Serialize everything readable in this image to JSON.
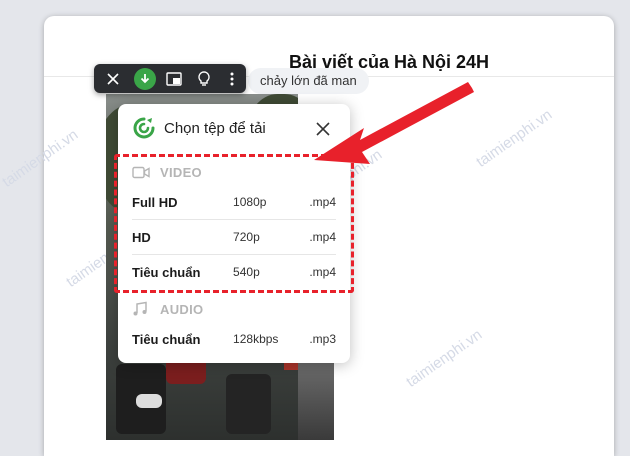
{
  "page": {
    "title": "Bài viết của Hà Nội 24H",
    "snippet": "chảy lớn đã man"
  },
  "watermark": "taimienphi.vn",
  "toolbar": {
    "buttons": [
      {
        "name": "close",
        "icon": "close-icon"
      },
      {
        "name": "download",
        "icon": "download-icon"
      },
      {
        "name": "picture-in-picture",
        "icon": "picture-in-picture-icon"
      },
      {
        "name": "tips",
        "icon": "lightbulb-icon"
      },
      {
        "name": "more",
        "icon": "more-vertical-icon"
      }
    ]
  },
  "popup": {
    "title": "Chọn tệp để tải",
    "video": {
      "label": "VIDEO",
      "items": [
        {
          "name": "Full HD",
          "res": "1080p",
          "ext": ".mp4"
        },
        {
          "name": "HD",
          "res": "720p",
          "ext": ".mp4"
        },
        {
          "name": "Tiêu chuẩn",
          "res": "540p",
          "ext": ".mp4"
        }
      ]
    },
    "audio": {
      "label": "AUDIO",
      "items": [
        {
          "name": "Tiêu chuẩn",
          "res": "128kbps",
          "ext": ".mp3"
        }
      ]
    }
  },
  "colors": {
    "accent_green": "#3aa548",
    "highlight_red": "#e8212b",
    "toolbar_bg": "#2b2d31"
  }
}
